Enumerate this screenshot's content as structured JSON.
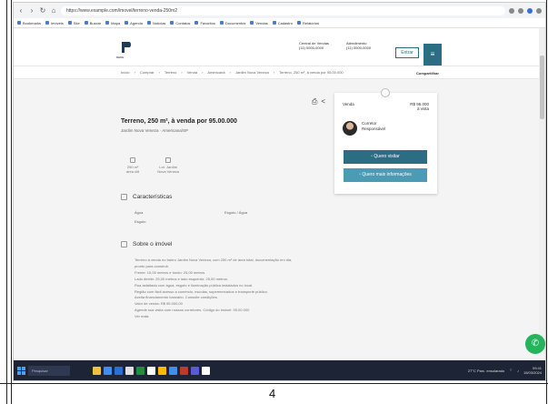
{
  "browser": {
    "url": "https://www.example.com/imovel/terreno-venda-250m2",
    "bookmarks": [
      "Bookmarks",
      "Imóveis",
      "Site",
      "Buscar",
      "Mapa",
      "Agenda",
      "Notícias",
      "Contatos",
      "Favoritos",
      "Documentos",
      "Vendas",
      "Cadastro",
      "Relatórios"
    ]
  },
  "header": {
    "logo_text": "REDE",
    "contact_1": [
      "Central de Vendas",
      "(11) 0000-0000"
    ],
    "contact_2": [
      "Atendimento",
      "(11) 0000-0000"
    ],
    "login_label": "Entrar",
    "menu_icon": "menu-icon"
  },
  "breadcrumb": {
    "items": [
      "Início",
      "Comprar",
      "Terreno",
      "Venda",
      "Americana",
      "Jardim Nova Veneza",
      "Terreno, 250 m², à venda por 95.00.000"
    ],
    "share_label": "Compartilhar"
  },
  "property": {
    "title": "Terreno, 250 m², à venda por 95.00.000",
    "subtitle": "Jardim Nova Veneza · Americana/SP",
    "stats": [
      {
        "label": "250 m²",
        "sub": "área útil"
      },
      {
        "label": "Lot. Jardim",
        "sub": "Nova Veneza"
      }
    ],
    "characteristics_heading": "Características",
    "characteristics": [
      {
        "label": "Água",
        "value": "Esgoto / Água"
      },
      {
        "label": "Esgoto",
        "value": ""
      }
    ],
    "about_heading": "Sobre o imóvel",
    "description": [
      "Terreno à venda no bairro Jardim Nova Veneza, com 250 m² de área total, documentação em dia,",
      "pronto para construir.",
      "Frente: 10,00 metros e fundo: 25,00 metros.",
      "Lado direito: 25,00 metros e lado esquerdo: 25,00 metros.",
      "Rua asfaltada com água, esgoto e iluminação pública instalados no local.",
      "Região com fácil acesso a comércio, escolas, supermercados e transporte público.",
      "Aceita financiamento bancário. Consulte condições.",
      "Valor de venda: R$ 95.000,00",
      "Agende sua visita com nossos corretores. Código do imóvel: 95.00.000",
      "Ver mais"
    ]
  },
  "contact_card": {
    "label": "Venda",
    "price_line1": "R$ 95.000",
    "price_line2": "à vista",
    "agent_name": "Corretor",
    "agent_role": "Responsável",
    "visit_button": "Quero visitar",
    "info_button": "Quero mais informações"
  },
  "taskbar": {
    "search_placeholder": "Pesquisar",
    "weather": "27°C Parc. ensolarado",
    "time": "09:41",
    "date": "15/03/2024",
    "icon_colors": [
      "#f0c040",
      "#3d8ef0",
      "#2a6fd6",
      "#e0e0e0",
      "#1f8f3a",
      "#ffffff",
      "#ffb900",
      "#3d8ef0",
      "#c03a2b",
      "#5a5ad6",
      "#ffffff"
    ]
  },
  "page_number": "4"
}
